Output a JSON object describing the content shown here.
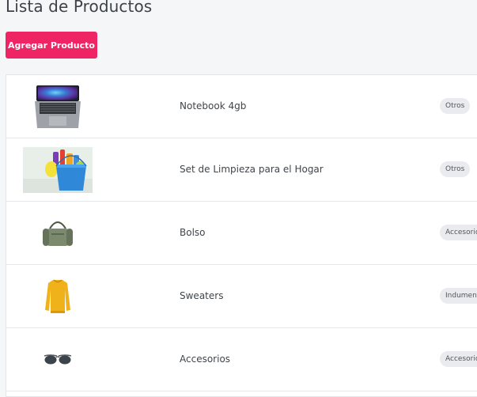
{
  "header": {
    "title": "Lista de Productos",
    "add_button_label": "Agregar Producto"
  },
  "products": [
    {
      "name": "Notebook 4gb",
      "category": "Otros",
      "image": "laptop-image"
    },
    {
      "name": "Set de Limpieza para el Hogar",
      "category": "Otros",
      "image": "cleaning-set-image"
    },
    {
      "name": "Bolso",
      "category": "Accesorios",
      "image": "duffel-bag-image"
    },
    {
      "name": "Sweaters",
      "category": "Indumentaria",
      "image": "yellow-sweater-image"
    },
    {
      "name": "Accesorios",
      "category": "Accesorios",
      "image": "sunglasses-image"
    }
  ],
  "colors": {
    "accent": "#ef2465",
    "background": "#f5f6f8",
    "badge": "#e9ebee"
  }
}
